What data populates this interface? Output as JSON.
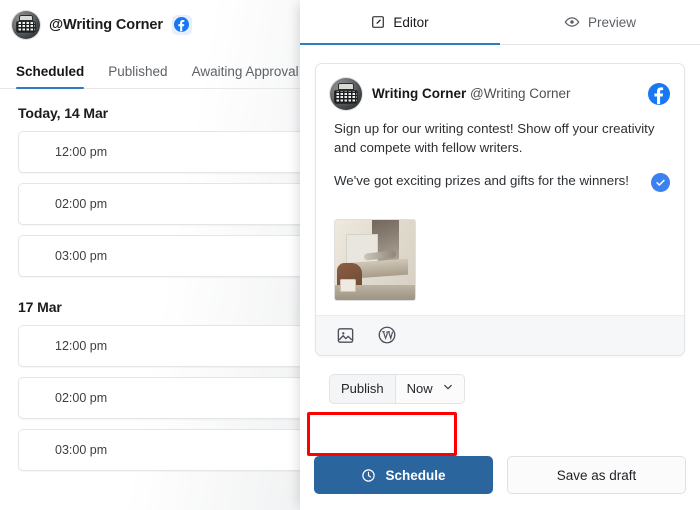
{
  "left": {
    "account": {
      "handle": "@Writing Corner",
      "avatar_icon": "typewriter-avatar",
      "network_icon": "facebook-icon"
    },
    "tabs": [
      {
        "label": "Scheduled",
        "active": true
      },
      {
        "label": "Published",
        "active": false
      },
      {
        "label": "Awaiting Approval",
        "active": false
      }
    ],
    "groups": [
      {
        "date": "Today, 14 Mar",
        "slots": [
          "12:00 pm",
          "02:00 pm",
          "03:00 pm"
        ]
      },
      {
        "date": "17 Mar",
        "slots": [
          "12:00 pm",
          "02:00 pm",
          "03:00 pm"
        ]
      }
    ]
  },
  "right": {
    "tabs": [
      {
        "label": "Editor",
        "icon": "edit-pencil-icon",
        "active": true
      },
      {
        "label": "Preview",
        "icon": "eye-icon",
        "active": false
      }
    ],
    "post": {
      "author_name": "Writing Corner",
      "author_handle": "@Writing Corner",
      "network_icon": "facebook-icon",
      "avatar_icon": "typewriter-avatar",
      "paragraphs": [
        "Sign up for our writing contest! Show off your creativity and compete with fellow writers.",
        "We've got exciting prizes and gifts for the winners!"
      ],
      "verified_badge_icon": "check-circle-icon",
      "attachment_icon": "image-thumbnail",
      "toolbar": [
        {
          "icon": "image-icon"
        },
        {
          "icon": "wordpress-icon"
        }
      ]
    },
    "publish": {
      "label": "Publish",
      "selected_value": "Now",
      "chevron_icon": "chevron-down-icon",
      "highlight_color": "#fe0000"
    },
    "actions": {
      "primary": {
        "label": "Schedule",
        "icon": "clock-icon",
        "color": "#2a669d"
      },
      "secondary": {
        "label": "Save as draft"
      }
    }
  }
}
